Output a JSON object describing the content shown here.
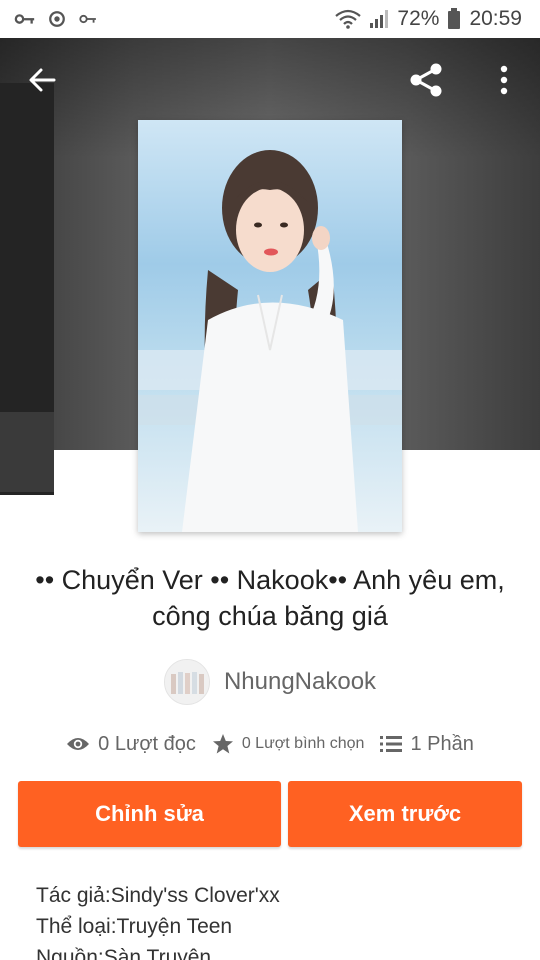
{
  "status_bar": {
    "battery_percent": "72%",
    "time": "20:59"
  },
  "story": {
    "title": "•• Chuyển Ver •• Nakook••  Anh yêu em, công chúa băng giá",
    "author": "NhungNakook",
    "reads_label": "0 Lượt đọc",
    "votes_label": "0 Lượt bình chọn",
    "parts_label": "1 Phần"
  },
  "actions": {
    "edit_label": "Chỉnh sửa",
    "preview_label": "Xem trước"
  },
  "details": {
    "author_line": "Tác giả:Sindy'ss Clover'xx",
    "genre_line": "Thể loại:Truyện Teen",
    "source_line": "Nguồn:Sàn Truyện"
  },
  "colors": {
    "accent": "#ff6122",
    "muted_text": "#666666"
  },
  "icons": [
    "key-icon",
    "sync-icon",
    "wifi-icon",
    "signal-icon",
    "battery-icon",
    "back-arrow-icon",
    "share-icon",
    "more-vert-icon",
    "eye-icon",
    "star-icon",
    "list-icon"
  ]
}
